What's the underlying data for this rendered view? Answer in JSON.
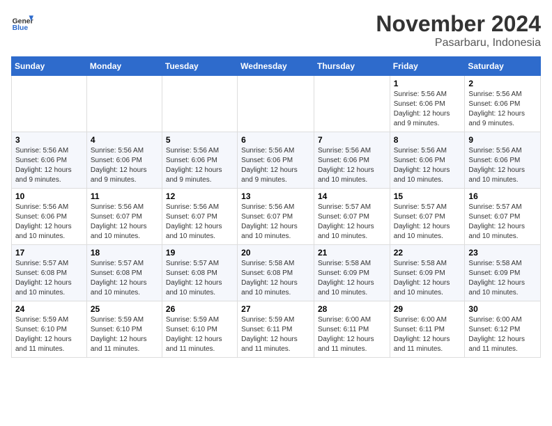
{
  "header": {
    "logo": {
      "general": "General",
      "blue": "Blue"
    },
    "title": "November 2024",
    "subtitle": "Pasarbaru, Indonesia"
  },
  "weekdays": [
    "Sunday",
    "Monday",
    "Tuesday",
    "Wednesday",
    "Thursday",
    "Friday",
    "Saturday"
  ],
  "weeks": [
    [
      {
        "day": "",
        "info": ""
      },
      {
        "day": "",
        "info": ""
      },
      {
        "day": "",
        "info": ""
      },
      {
        "day": "",
        "info": ""
      },
      {
        "day": "",
        "info": ""
      },
      {
        "day": "1",
        "info": "Sunrise: 5:56 AM\nSunset: 6:06 PM\nDaylight: 12 hours and 9 minutes."
      },
      {
        "day": "2",
        "info": "Sunrise: 5:56 AM\nSunset: 6:06 PM\nDaylight: 12 hours and 9 minutes."
      }
    ],
    [
      {
        "day": "3",
        "info": "Sunrise: 5:56 AM\nSunset: 6:06 PM\nDaylight: 12 hours and 9 minutes."
      },
      {
        "day": "4",
        "info": "Sunrise: 5:56 AM\nSunset: 6:06 PM\nDaylight: 12 hours and 9 minutes."
      },
      {
        "day": "5",
        "info": "Sunrise: 5:56 AM\nSunset: 6:06 PM\nDaylight: 12 hours and 9 minutes."
      },
      {
        "day": "6",
        "info": "Sunrise: 5:56 AM\nSunset: 6:06 PM\nDaylight: 12 hours and 9 minutes."
      },
      {
        "day": "7",
        "info": "Sunrise: 5:56 AM\nSunset: 6:06 PM\nDaylight: 12 hours and 10 minutes."
      },
      {
        "day": "8",
        "info": "Sunrise: 5:56 AM\nSunset: 6:06 PM\nDaylight: 12 hours and 10 minutes."
      },
      {
        "day": "9",
        "info": "Sunrise: 5:56 AM\nSunset: 6:06 PM\nDaylight: 12 hours and 10 minutes."
      }
    ],
    [
      {
        "day": "10",
        "info": "Sunrise: 5:56 AM\nSunset: 6:06 PM\nDaylight: 12 hours and 10 minutes."
      },
      {
        "day": "11",
        "info": "Sunrise: 5:56 AM\nSunset: 6:07 PM\nDaylight: 12 hours and 10 minutes."
      },
      {
        "day": "12",
        "info": "Sunrise: 5:56 AM\nSunset: 6:07 PM\nDaylight: 12 hours and 10 minutes."
      },
      {
        "day": "13",
        "info": "Sunrise: 5:56 AM\nSunset: 6:07 PM\nDaylight: 12 hours and 10 minutes."
      },
      {
        "day": "14",
        "info": "Sunrise: 5:57 AM\nSunset: 6:07 PM\nDaylight: 12 hours and 10 minutes."
      },
      {
        "day": "15",
        "info": "Sunrise: 5:57 AM\nSunset: 6:07 PM\nDaylight: 12 hours and 10 minutes."
      },
      {
        "day": "16",
        "info": "Sunrise: 5:57 AM\nSunset: 6:07 PM\nDaylight: 12 hours and 10 minutes."
      }
    ],
    [
      {
        "day": "17",
        "info": "Sunrise: 5:57 AM\nSunset: 6:08 PM\nDaylight: 12 hours and 10 minutes."
      },
      {
        "day": "18",
        "info": "Sunrise: 5:57 AM\nSunset: 6:08 PM\nDaylight: 12 hours and 10 minutes."
      },
      {
        "day": "19",
        "info": "Sunrise: 5:57 AM\nSunset: 6:08 PM\nDaylight: 12 hours and 10 minutes."
      },
      {
        "day": "20",
        "info": "Sunrise: 5:58 AM\nSunset: 6:08 PM\nDaylight: 12 hours and 10 minutes."
      },
      {
        "day": "21",
        "info": "Sunrise: 5:58 AM\nSunset: 6:09 PM\nDaylight: 12 hours and 10 minutes."
      },
      {
        "day": "22",
        "info": "Sunrise: 5:58 AM\nSunset: 6:09 PM\nDaylight: 12 hours and 10 minutes."
      },
      {
        "day": "23",
        "info": "Sunrise: 5:58 AM\nSunset: 6:09 PM\nDaylight: 12 hours and 10 minutes."
      }
    ],
    [
      {
        "day": "24",
        "info": "Sunrise: 5:59 AM\nSunset: 6:10 PM\nDaylight: 12 hours and 11 minutes."
      },
      {
        "day": "25",
        "info": "Sunrise: 5:59 AM\nSunset: 6:10 PM\nDaylight: 12 hours and 11 minutes."
      },
      {
        "day": "26",
        "info": "Sunrise: 5:59 AM\nSunset: 6:10 PM\nDaylight: 12 hours and 11 minutes."
      },
      {
        "day": "27",
        "info": "Sunrise: 5:59 AM\nSunset: 6:11 PM\nDaylight: 12 hours and 11 minutes."
      },
      {
        "day": "28",
        "info": "Sunrise: 6:00 AM\nSunset: 6:11 PM\nDaylight: 12 hours and 11 minutes."
      },
      {
        "day": "29",
        "info": "Sunrise: 6:00 AM\nSunset: 6:11 PM\nDaylight: 12 hours and 11 minutes."
      },
      {
        "day": "30",
        "info": "Sunrise: 6:00 AM\nSunset: 6:12 PM\nDaylight: 12 hours and 11 minutes."
      }
    ]
  ]
}
